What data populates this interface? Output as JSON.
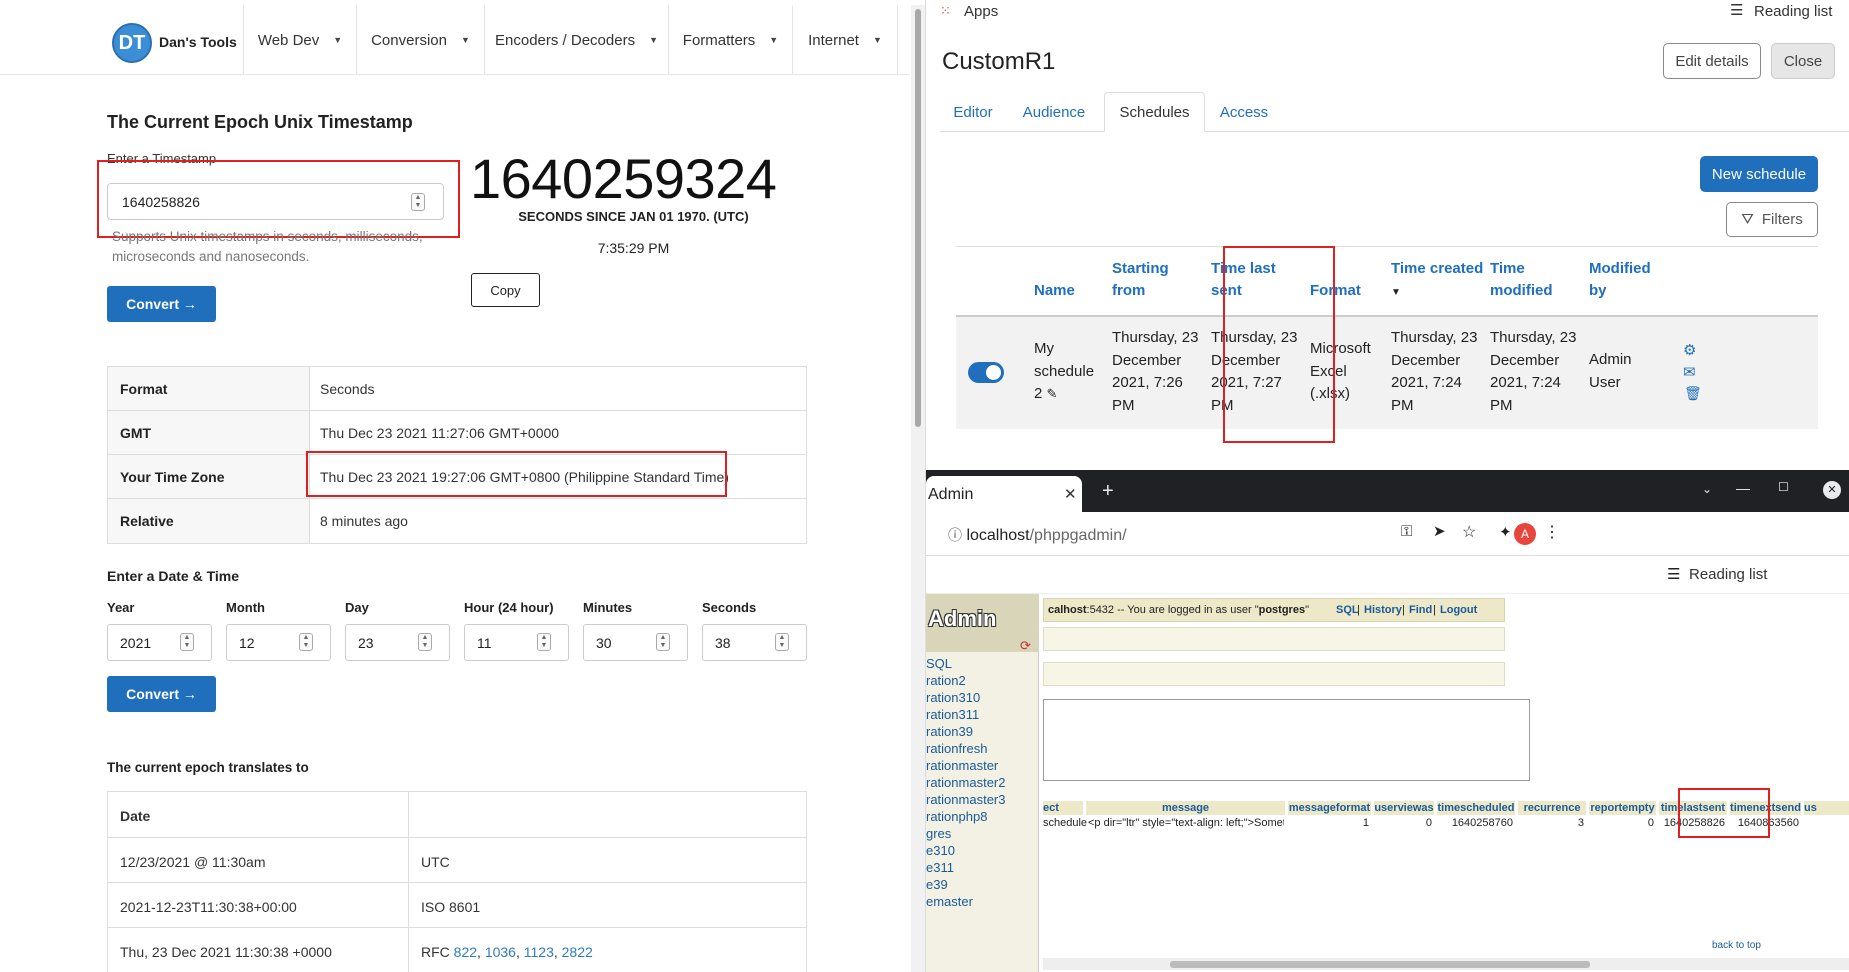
{
  "left": {
    "brand": "Dan's Tools",
    "logo_text": "DT",
    "nav": [
      {
        "label": "Web Dev"
      },
      {
        "label": "Conversion"
      },
      {
        "label": "Encoders / Decoders"
      },
      {
        "label": "Formatters"
      },
      {
        "label": "Internet"
      }
    ],
    "title": "The Current Epoch Unix Timestamp",
    "enter_label": "Enter a Timestamp",
    "timestamp_input": "1640258826",
    "help_text": "Supports Unix timestamps in seconds, milliseconds, microseconds and nanoseconds.",
    "current_epoch": "1640259324",
    "seconds_since": "SECONDS SINCE JAN 01 1970. (UTC)",
    "current_time": "7:35:29 PM",
    "copy_label": "Copy",
    "convert_label": "Convert →",
    "result": [
      {
        "key": "Format",
        "value": "Seconds"
      },
      {
        "key": "GMT",
        "value": "Thu Dec 23 2021 11:27:06 GMT+0000"
      },
      {
        "key": "Your Time Zone",
        "value": "Thu Dec 23 2021 19:27:06 GMT+0800 (Philippine Standard Time)"
      },
      {
        "key": "Relative",
        "value": "8 minutes ago"
      }
    ],
    "date_title": "Enter a Date & Time",
    "date_fields": [
      {
        "label": "Year",
        "value": "2021"
      },
      {
        "label": "Month",
        "value": "12"
      },
      {
        "label": "Day",
        "value": "23"
      },
      {
        "label": "Hour (24 hour)",
        "value": "11"
      },
      {
        "label": "Minutes",
        "value": "30"
      },
      {
        "label": "Seconds",
        "value": "38"
      }
    ],
    "translates_title": "The current epoch translates to",
    "translate_header": "Date",
    "translate_rows": [
      {
        "value": "12/23/2021 @ 11:30am",
        "format": "UTC"
      },
      {
        "value": "2021-12-23T11:30:38+00:00",
        "format": "ISO 8601"
      },
      {
        "value": "Thu, 23 Dec 2021 11:30:38 +0000",
        "format_prefix": "RFC",
        "rfcs": [
          "822",
          "1036",
          "1123",
          "2822"
        ]
      }
    ]
  },
  "right_top": {
    "apps_label": "Apps",
    "reading_list": "Reading list",
    "title": "CustomR1",
    "edit_details": "Edit details",
    "close": "Close",
    "tabs": [
      {
        "label": "Editor"
      },
      {
        "label": "Audience"
      },
      {
        "label": "Schedules"
      },
      {
        "label": "Access"
      }
    ],
    "new_schedule": "New schedule",
    "filters": "Filters",
    "columns": {
      "name": "Name",
      "starting_from_1": "Starting",
      "starting_from_2": "from",
      "time_last_sent_1": "Time last",
      "time_last_sent_2": "sent",
      "format": "Format",
      "time_created": "Time created",
      "time_modified_1": "Time",
      "time_modified_2": "modified",
      "modified_by_1": "Modified",
      "modified_by_2": "by"
    },
    "row": {
      "name_1": "My",
      "name_2": "schedule",
      "name_3": "2",
      "starting_1": "Thursday, 23",
      "starting_2": "December",
      "starting_3": "2021, 7:26",
      "starting_4": "PM",
      "lastsent_1": "Thursday, 23",
      "lastsent_2": "December",
      "lastsent_3": "2021, 7:27",
      "lastsent_4": "PM",
      "format_1": "Microsoft",
      "format_2": "Excel",
      "format_3": "(.xlsx)",
      "created_1": "Thursday, 23",
      "created_2": "December",
      "created_3": "2021, 7:24",
      "created_4": "PM",
      "modified_1": "Thursday, 23",
      "modified_2": "December",
      "modified_3": "2021, 7:24",
      "modified_4": "PM",
      "by_1": "Admin",
      "by_2": "User"
    }
  },
  "right_bottom": {
    "tab_title": "Admin",
    "url_host": "localhost",
    "url_path": "/phppgadmin/",
    "reading_list": "Reading list",
    "avatar_letter": "A",
    "logo_text": "Admin",
    "topbar_host": "calhost",
    "topbar_text": ":5432 -- You are logged in as user \"",
    "topbar_user": "postgres",
    "topbar_end": "\"",
    "links": [
      "SQL",
      "History",
      "Find",
      "Logout"
    ],
    "databases": [
      "SQL",
      "ration2",
      "ration310",
      "ration311",
      "ration39",
      "rationfresh",
      "rationmaster",
      "rationmaster2",
      "rationmaster3",
      "rationphp8",
      "gres",
      "e310",
      "e311",
      "e39",
      "emaster"
    ],
    "columns": [
      "ect",
      "message",
      "messageformat",
      "userviewas",
      "timescheduled",
      "recurrence",
      "reportempty",
      "timelastsent",
      "timenextsend",
      "us"
    ],
    "cells": [
      "schedule",
      "<p dir=\"ltr\" style=\"text-align: left;\">Something ...",
      "1",
      "0",
      "1640258760",
      "3",
      "0",
      "1640258826",
      "1640863560"
    ],
    "back_to_top": "back to top"
  }
}
